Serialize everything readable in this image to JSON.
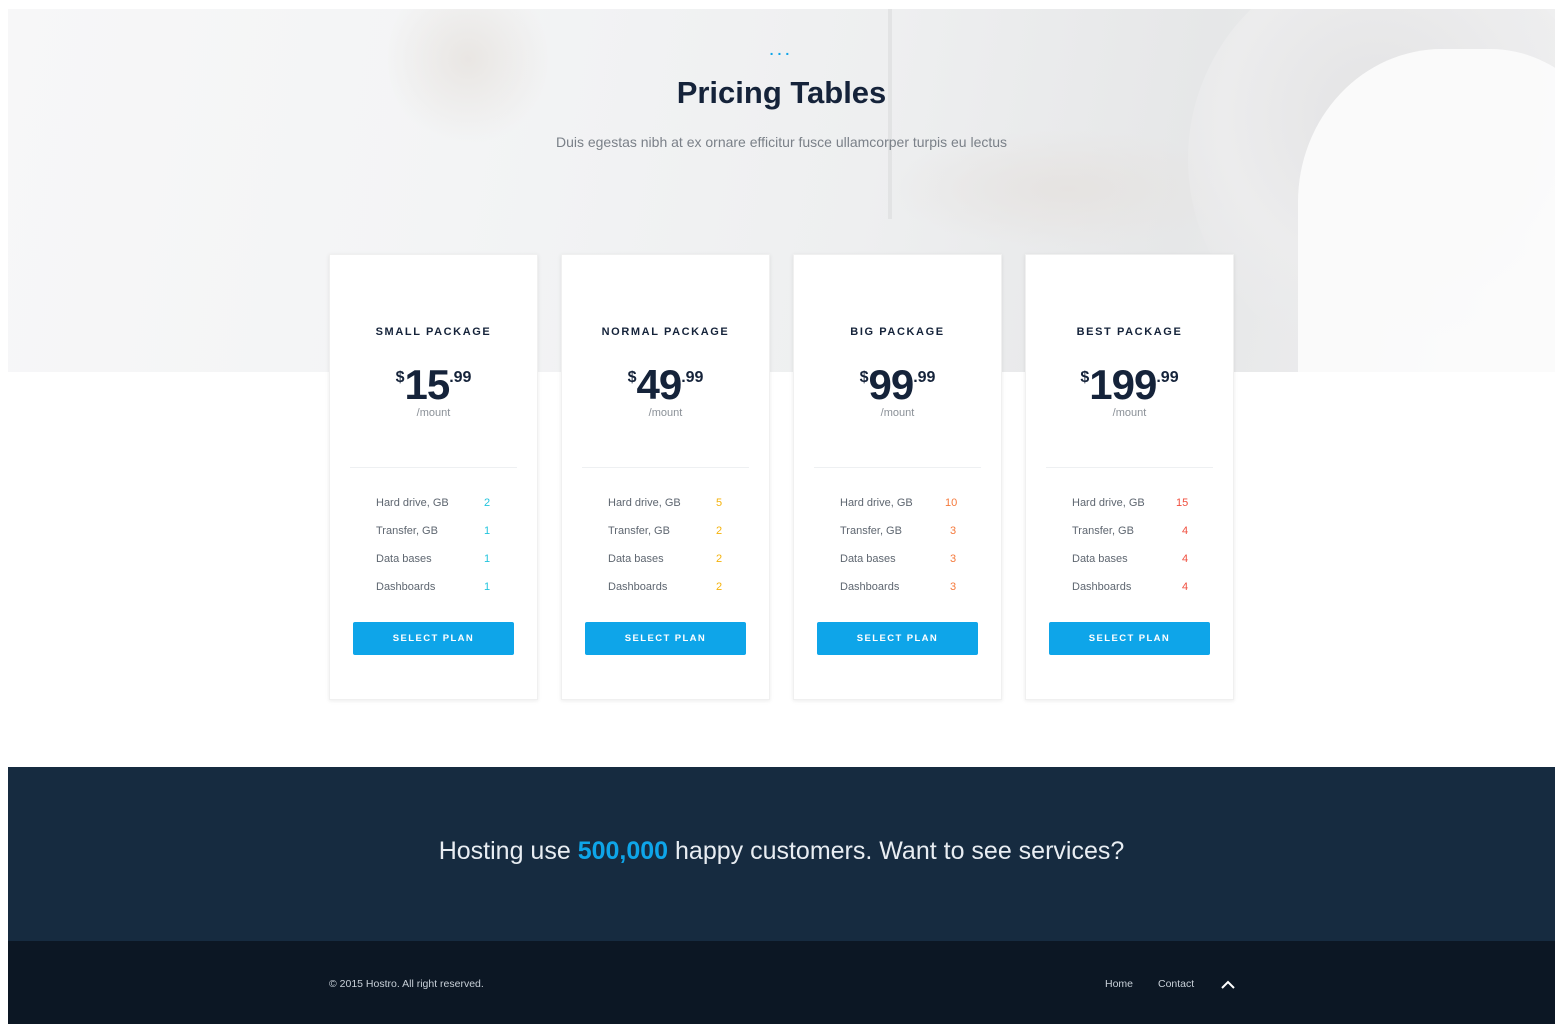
{
  "hero": {
    "dots": "...",
    "title": "Pricing Tables",
    "subtitle": "Duis egestas nibh at ex ornare efficitur fusce ullamcorper turpis eu lectus"
  },
  "plans": [
    {
      "name": "SMALL PACKAGE",
      "currency": "$",
      "amount": "15",
      "cents": ".99",
      "period": "/mount",
      "value_color": "#22c4dd",
      "features": [
        {
          "label": "Hard drive, GB",
          "value": "2"
        },
        {
          "label": "Transfer, GB",
          "value": "1"
        },
        {
          "label": "Data bases",
          "value": "1"
        },
        {
          "label": "Dashboards",
          "value": "1"
        }
      ],
      "button": "SELECT PLAN"
    },
    {
      "name": "NORMAL PACKAGE",
      "currency": "$",
      "amount": "49",
      "cents": ".99",
      "period": "/mount",
      "value_color": "#f5b20a",
      "features": [
        {
          "label": "Hard drive, GB",
          "value": "5"
        },
        {
          "label": "Transfer, GB",
          "value": "2"
        },
        {
          "label": "Data bases",
          "value": "2"
        },
        {
          "label": "Dashboards",
          "value": "2"
        }
      ],
      "button": "SELECT PLAN"
    },
    {
      "name": "BIG PACKAGE",
      "currency": "$",
      "amount": "99",
      "cents": ".99",
      "period": "/mount",
      "value_color": "#f5793b",
      "features": [
        {
          "label": "Hard drive, GB",
          "value": "10"
        },
        {
          "label": "Transfer, GB",
          "value": "3"
        },
        {
          "label": "Data bases",
          "value": "3"
        },
        {
          "label": "Dashboards",
          "value": "3"
        }
      ],
      "button": "SELECT PLAN"
    },
    {
      "name": "BEST PACKAGE",
      "currency": "$",
      "amount": "199",
      "cents": ".99",
      "period": "/mount",
      "value_color": "#f04e3e",
      "features": [
        {
          "label": "Hard drive, GB",
          "value": "15"
        },
        {
          "label": "Transfer, GB",
          "value": "4"
        },
        {
          "label": "Data bases",
          "value": "4"
        },
        {
          "label": "Dashboards",
          "value": "4"
        }
      ],
      "button": "SELECT PLAN"
    }
  ],
  "cta": {
    "before": "Hosting use ",
    "highlight": "500,000",
    "after": " happy customers. Want to see services?"
  },
  "footer": {
    "copyright": "© 2015 Hostro. All right reserved.",
    "links": [
      "Home",
      "Contact"
    ],
    "back_to_top_icon": "chevron-up-icon"
  },
  "colors": {
    "accent": "#0ea5e9",
    "navy": "#15233a",
    "cta_bg": "#162b40",
    "footer_bg": "#0c1724"
  }
}
